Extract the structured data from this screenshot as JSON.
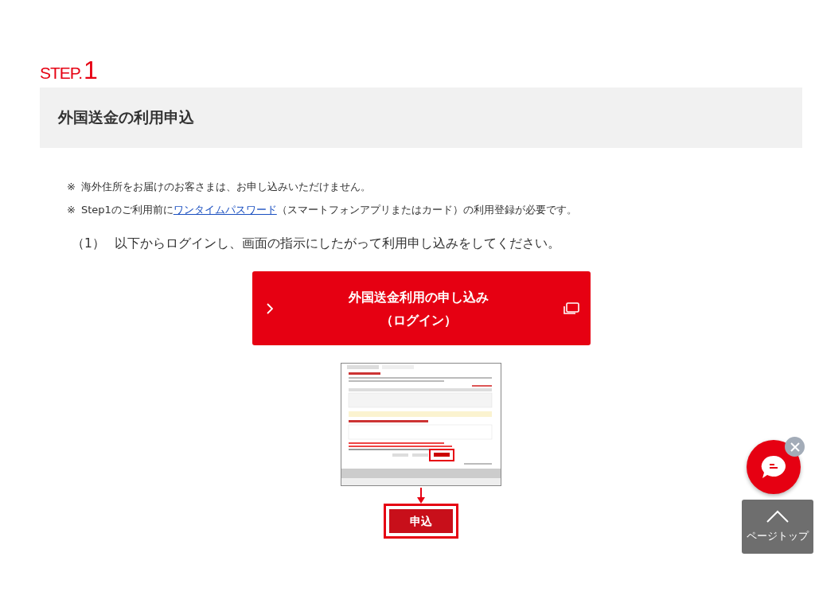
{
  "step": {
    "label": "STEP.",
    "number": "1"
  },
  "section_title": "外国送金の利用申込",
  "notes": [
    {
      "mark": "※",
      "before": "海外住所をお届けのお客さまは、お申し込みいただけません。"
    },
    {
      "mark": "※",
      "before": "Step1のご利用前に",
      "link": "ワンタイムパスワード",
      "after": "（スマートフォンアプリまたはカード）の利用登録が必要です。"
    }
  ],
  "instruction": {
    "number": "（1）",
    "text": "以下からログインし、画面の指示にしたがって利用申し込みをしてください。"
  },
  "login_button": {
    "line1": "外国送金利用の申し込み",
    "line2": "（ログイン）"
  },
  "example": {
    "kind": "screenshot",
    "callout_button": "申込"
  },
  "page_top": {
    "label": "ページトップ"
  }
}
